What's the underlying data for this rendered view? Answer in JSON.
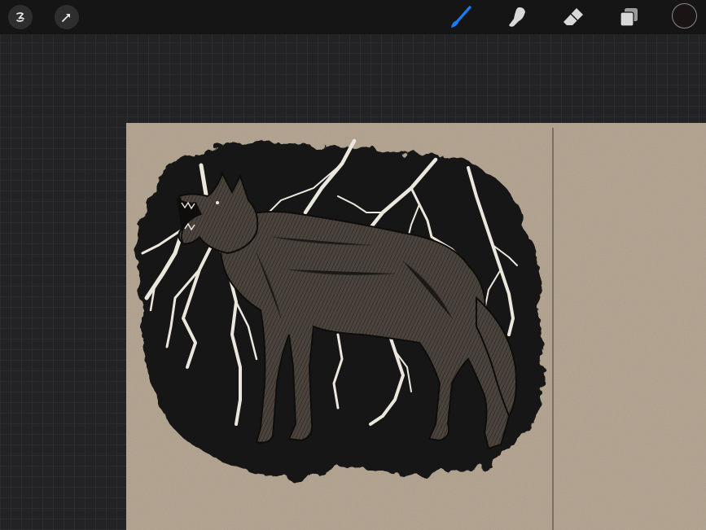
{
  "toolbar": {
    "left_buttons": [
      {
        "name": "adjustments",
        "icon": "adjustments-wand-icon"
      },
      {
        "name": "selection",
        "icon": "selection-arrow-icon"
      }
    ],
    "tools": [
      {
        "name": "brush",
        "icon": "brush-icon",
        "active": true
      },
      {
        "name": "smudge",
        "icon": "smudge-finger-icon",
        "active": false
      },
      {
        "name": "eraser",
        "icon": "eraser-icon",
        "active": false
      },
      {
        "name": "layers",
        "icon": "layers-icon",
        "active": false
      }
    ],
    "color": "#1a1414"
  },
  "colors": {
    "toolbar_bg": "#151515",
    "workspace_bg": "#232325",
    "paper": "#b0a08c",
    "active_tool": "#1a7cf0",
    "inactive_tool": "#d8d8d8",
    "ink": "#141312",
    "lightning": "#ece7dd",
    "wolf_fur": "#4d473f"
  },
  "canvas": {
    "artwork": "wolf-howling-lightning-illustration"
  }
}
